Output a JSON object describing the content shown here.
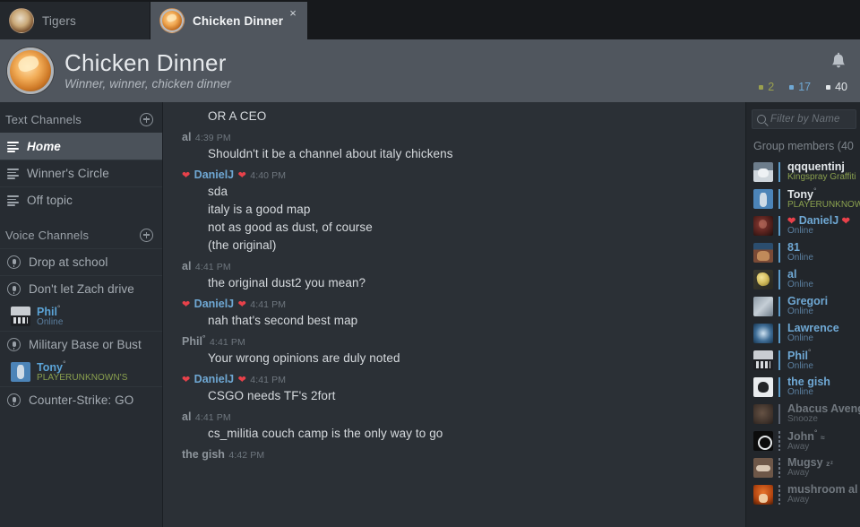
{
  "tabs": [
    {
      "label": "Tigers",
      "icon": "tigers-avatar-icon",
      "active": false
    },
    {
      "label": "Chicken Dinner",
      "icon": "chicken-avatar-icon",
      "active": true,
      "close": "×"
    }
  ],
  "group_header": {
    "title": "Chicken Dinner",
    "subtitle": "Winner, winner, chicken dinner",
    "avatar_icon": "chicken-avatar-icon",
    "bell_icon": "notification-bell-icon",
    "counters": [
      {
        "value": "2",
        "color": "#9aa04e"
      },
      {
        "value": "17",
        "color": "#6fa8d4"
      },
      {
        "value": "40",
        "color": "#e3e7ea"
      }
    ]
  },
  "sidebar": {
    "text_section": {
      "title": "Text Channels",
      "add_icon": "plus-circle-icon"
    },
    "text_channels": [
      {
        "name": "Home",
        "selected": true
      },
      {
        "name": "Winner's Circle",
        "selected": false
      },
      {
        "name": "Off topic",
        "selected": false
      }
    ],
    "voice_section": {
      "title": "Voice Channels",
      "add_icon": "plus-circle-icon"
    },
    "voice_channels": [
      {
        "name": "Drop at school",
        "members": []
      },
      {
        "name": "Don't let Zach drive",
        "members": [
          {
            "name": "Phil",
            "star": "°",
            "status": "Online",
            "status_kind": "online",
            "avatar": "phil-avatar"
          }
        ]
      },
      {
        "name": "Military Base or Bust",
        "members": [
          {
            "name": "Tony",
            "star": "°",
            "status": "PLAYERUNKNOWN'S",
            "status_kind": "ingame",
            "avatar": "tony-avatar"
          }
        ]
      },
      {
        "name": "Counter-Strike: GO",
        "members": []
      }
    ]
  },
  "chat": {
    "messages": [
      {
        "partial": true,
        "lines": [
          "OR A CEO"
        ]
      },
      {
        "author": "al",
        "time": "4:39 PM",
        "avatar": "al-avatar",
        "name_color": "gray",
        "bar": "online",
        "lines": [
          "Shouldn't it be a channel about italy chickens"
        ]
      },
      {
        "author": "DanielJ",
        "time": "4:40 PM",
        "avatar": "daniel-avatar",
        "name_color": "blue",
        "bar": "online",
        "heart_left": "❤",
        "heart_right": "❤",
        "lines": [
          "sda",
          "italy is a good map",
          "not as good as dust, of course",
          "(the original)"
        ]
      },
      {
        "author": "al",
        "time": "4:41 PM",
        "avatar": "al-avatar",
        "name_color": "gray",
        "bar": "online",
        "lines": [
          "the original dust2 you mean?"
        ]
      },
      {
        "author": "DanielJ",
        "time": "4:41 PM",
        "avatar": "daniel-avatar",
        "name_color": "blue",
        "bar": "online",
        "heart_left": "❤",
        "heart_right": "❤",
        "lines": [
          "nah that's second best map"
        ]
      },
      {
        "author": "Phil",
        "star": "°",
        "time": "4:41 PM",
        "avatar": "phil-avatar",
        "name_color": "gray",
        "bar": "online",
        "lines": [
          "Your wrong opinions are duly noted"
        ]
      },
      {
        "author": "DanielJ",
        "time": "4:41 PM",
        "avatar": "daniel-avatar",
        "name_color": "blue",
        "bar": "online",
        "heart_left": "❤",
        "heart_right": "❤",
        "lines": [
          "CSGO needs TF's 2fort"
        ]
      },
      {
        "author": "al",
        "time": "4:41 PM",
        "avatar": "al-avatar",
        "name_color": "gray",
        "bar": "online",
        "lines": [
          "cs_militia couch camp is the only way to go"
        ]
      },
      {
        "author": "the gish",
        "time": "4:42 PM",
        "avatar": "gish-avatar",
        "name_color": "gray",
        "bar": "online",
        "cut_off": true,
        "lines": []
      }
    ]
  },
  "members_panel": {
    "filter_placeholder": "Filter by Name",
    "filter_value": "",
    "filter_icon": "search-icon",
    "heading": "Group members",
    "heading_count": "(40",
    "members": [
      {
        "name": "qqquentinj",
        "sub": "Kingspray Graffiti",
        "sub_kind": "game",
        "bar": "online",
        "name_kind": "white",
        "avatar": "qq-avatar"
      },
      {
        "name": "Tony",
        "star": "°",
        "sub": "PLAYERUNKNOWN",
        "sub_kind": "game",
        "bar": "online",
        "name_kind": "white",
        "avatar": "tony-avatar"
      },
      {
        "name": "DanielJ",
        "sub": "Online",
        "sub_kind": "online",
        "bar": "online",
        "name_kind": "blue",
        "avatar": "daniel-avatar",
        "heart_left": "❤",
        "heart_right": "❤"
      },
      {
        "name": "81",
        "sub": "Online",
        "sub_kind": "online",
        "bar": "online",
        "name_kind": "blue",
        "avatar": "81-avatar"
      },
      {
        "name": "al",
        "sub": "Online",
        "sub_kind": "online",
        "bar": "online",
        "name_kind": "blue",
        "avatar": "al-avatar"
      },
      {
        "name": "Gregori",
        "sub": "Online",
        "sub_kind": "online",
        "bar": "online",
        "name_kind": "blue",
        "avatar": "gregori-avatar"
      },
      {
        "name": "Lawrence",
        "sub": "Online",
        "sub_kind": "online",
        "bar": "online",
        "name_kind": "blue",
        "avatar": "lawrence-avatar"
      },
      {
        "name": "Phil",
        "star": "°",
        "sub": "Online",
        "sub_kind": "online",
        "bar": "online",
        "name_kind": "blue",
        "avatar": "phil-avatar"
      },
      {
        "name": "the gish",
        "sub": "Online",
        "sub_kind": "online",
        "bar": "online",
        "name_kind": "blue",
        "avatar": "gish-avatar"
      },
      {
        "name": "Abacus Aveng",
        "sub": "Snooze",
        "sub_kind": "dim",
        "bar": "snooze",
        "name_kind": "dim",
        "avatar": "abacus-avatar"
      },
      {
        "name": "John",
        "star": "°",
        "sub": "Away",
        "sub_kind": "dim",
        "bar": "away",
        "name_kind": "dim",
        "avatar": "john-avatar",
        "zzz": "≈"
      },
      {
        "name": "Mugsy",
        "sub": "Away",
        "sub_kind": "dim",
        "bar": "away",
        "name_kind": "dim",
        "avatar": "mugsy-avatar",
        "zzz": "zᶻ"
      },
      {
        "name": "mushroom al",
        "sub": "Away",
        "sub_kind": "dim",
        "bar": "away",
        "name_kind": "dim",
        "avatar": "mushroom-avatar"
      }
    ]
  }
}
